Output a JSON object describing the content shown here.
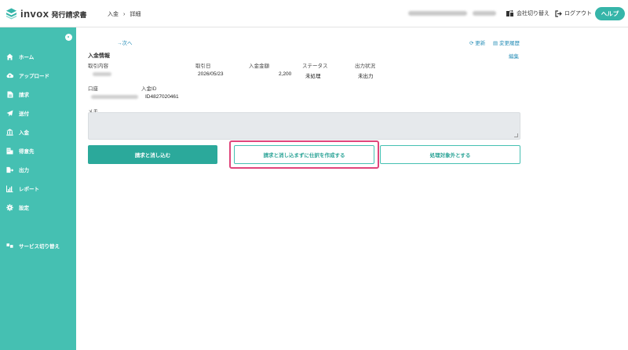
{
  "header": {
    "logo_text": "invox",
    "logo_sub": "発行請求書",
    "breadcrumb": [
      "入金",
      "詳細"
    ],
    "switch_company": "会社切り替え",
    "logout": "ログアウト",
    "help": "ヘルプ"
  },
  "sidebar": {
    "items": [
      {
        "label": "ホーム",
        "icon": "home-icon"
      },
      {
        "label": "アップロード",
        "icon": "cloud-upload-icon"
      },
      {
        "label": "請求",
        "icon": "document-icon"
      },
      {
        "label": "送付",
        "icon": "send-icon"
      },
      {
        "label": "入金",
        "icon": "bank-icon"
      },
      {
        "label": "得意先",
        "icon": "building-icon"
      },
      {
        "label": "出力",
        "icon": "export-icon"
      },
      {
        "label": "レポート",
        "icon": "chart-icon"
      },
      {
        "label": "設定",
        "icon": "gear-icon"
      },
      {
        "label": "サービス切り替え",
        "icon": "switch-icon"
      }
    ]
  },
  "main": {
    "next": "→次へ",
    "refresh": "更新",
    "history": "変更履歴",
    "edit": "編集",
    "section_title": "入金情報",
    "fields": {
      "transaction_content_label": "取引内容",
      "transaction_date_label": "取引日",
      "transaction_date_value": "2026/05/23",
      "amount_label": "入金金額",
      "amount_value": "2,200",
      "status_label": "ステータス",
      "status_value": "未処理",
      "output_label": "出力状況",
      "output_value": "未出力",
      "account_label": "口座",
      "payment_id_label": "入金ID",
      "payment_id_value": "ID4827020461",
      "memo_label": "メモ",
      "memo_value": ""
    },
    "buttons": {
      "reconcile": "請求と消し込む",
      "journal_without_reconcile": "請求と消し込まずに仕訳を作成する",
      "exclude": "処理対象外とする"
    }
  },
  "colors": {
    "accent": "#45c0b2",
    "primary_button": "#2ba99b",
    "link": "#2a8fb8",
    "highlight": "#e0457b"
  }
}
